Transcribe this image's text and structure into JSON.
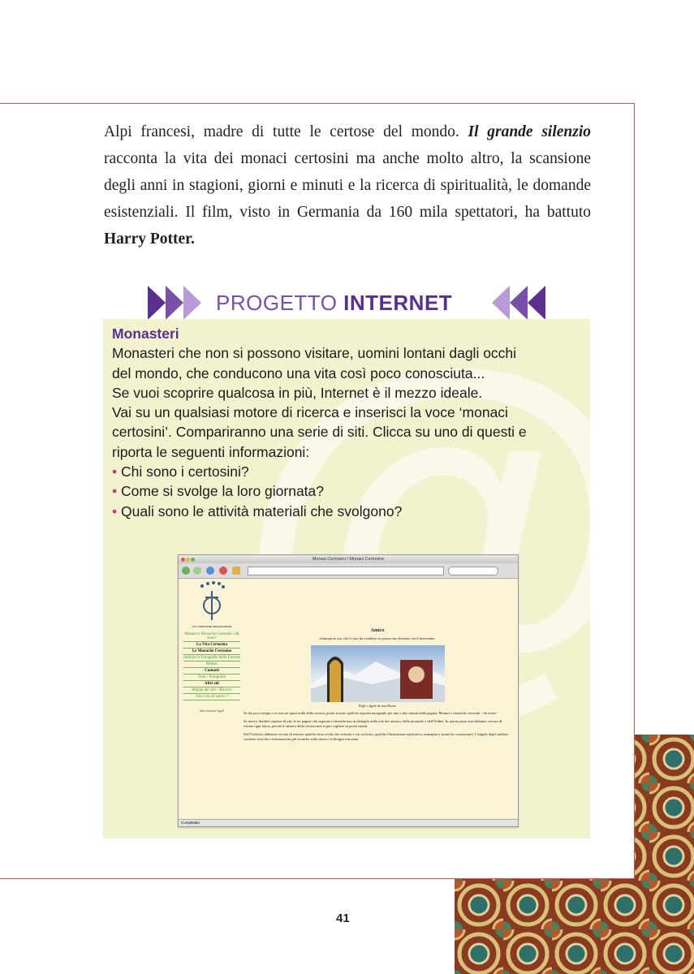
{
  "intro": {
    "t1": "Alpi francesi, madre di tutte le certose del mondo. ",
    "film": "Il grande silenzio",
    "t2": " racconta la vita dei monaci certosini ma anche molto altro, la scansione degli anni in stagioni, giorni e minuti e la ricerca di spiritualità, le domande esistenziali. Il film, visto in Germania da 160 mila spettatori, ha battuto ",
    "hp": "Harry Potter."
  },
  "header": {
    "light": "PROGETTO",
    "bold": "INTERNET"
  },
  "panel": {
    "heading": "Monasteri",
    "lines": [
      "Monasteri che non si possono visitare, uomini lontani dagli occhi",
      "del mondo, che conducono una vita così poco conosciuta...",
      "Se vuoi scoprire qualcosa in più, Internet è il mezzo ideale.",
      "Vai su un qualsiasi motore di ricerca e inserisci la voce ‘monaci",
      "certosini’. Compariranno una serie di siti. Clicca su uno di questi e",
      "riporta le seguenti informazioni:"
    ],
    "bullets": [
      "Chi sono i certosini?",
      "Come si svolge la loro giornata?",
      "Quali sono le attività materiali che svolgono?"
    ]
  },
  "browser": {
    "window_title": "Monaci Certosini / Monaci Certosine",
    "logo_caption": "GLI CERTOSINI MONASTERIO",
    "sidebar": [
      {
        "label": "Monaci e Monache Certosini: chi sono?",
        "style": "g"
      },
      {
        "label": "La Vita Certosina",
        "style": "k"
      },
      {
        "label": "Le Monache Certosine",
        "style": "k"
      },
      {
        "label": "Indirizzi e Fotografie delle Certose",
        "style": "g"
      },
      {
        "label": "Mimos",
        "style": "g"
      },
      {
        "label": "Contatti",
        "style": "k"
      },
      {
        "label": "Testi - Fotografie",
        "style": "g"
      },
      {
        "label": "Altri siti",
        "style": "k"
      },
      {
        "label": "Mappa del sito - Ricerca",
        "style": "g"
      },
      {
        "label": "Che cosa di nuovo ?",
        "style": "g"
      }
    ],
    "legal": "Informazioni legali",
    "amico": "Amico",
    "welcome": "chiunque tu sia, che il caso ha condotto su questo sito Internet, sei il benvenuto.",
    "caption": "Figli e figlie di san Bruno",
    "paragraphs": [
      "Se hai poco tempo e se non sai quasi nulla della certosa, potrai trovare qualche risposta navigando per uno o due minuti nella pagina: Monaci e monache certosini : chi sono?",
      "Se invece desideri saperne di più, le tre pagine che seguono ti introducono in dettaglio nella vita dei monaci, delle monache e dell'Ordine. In questa parte non abbiamo cercato di evitare ogni fatica, perché il mistero della certosa non si può cogliere in pochi istanti.",
      "Nell'Archivio abbiamo cercato di inserire qualche testo scritto da certosini e sui certosini, qualche illustrazione esplicativa, immagini e suoni (in costruzione). L'angolo degli studiosi contiene ricerche e informazioni più tecniche sulla storia e la liturgia certosina."
    ],
    "status": "Completato"
  },
  "page_number": "41"
}
